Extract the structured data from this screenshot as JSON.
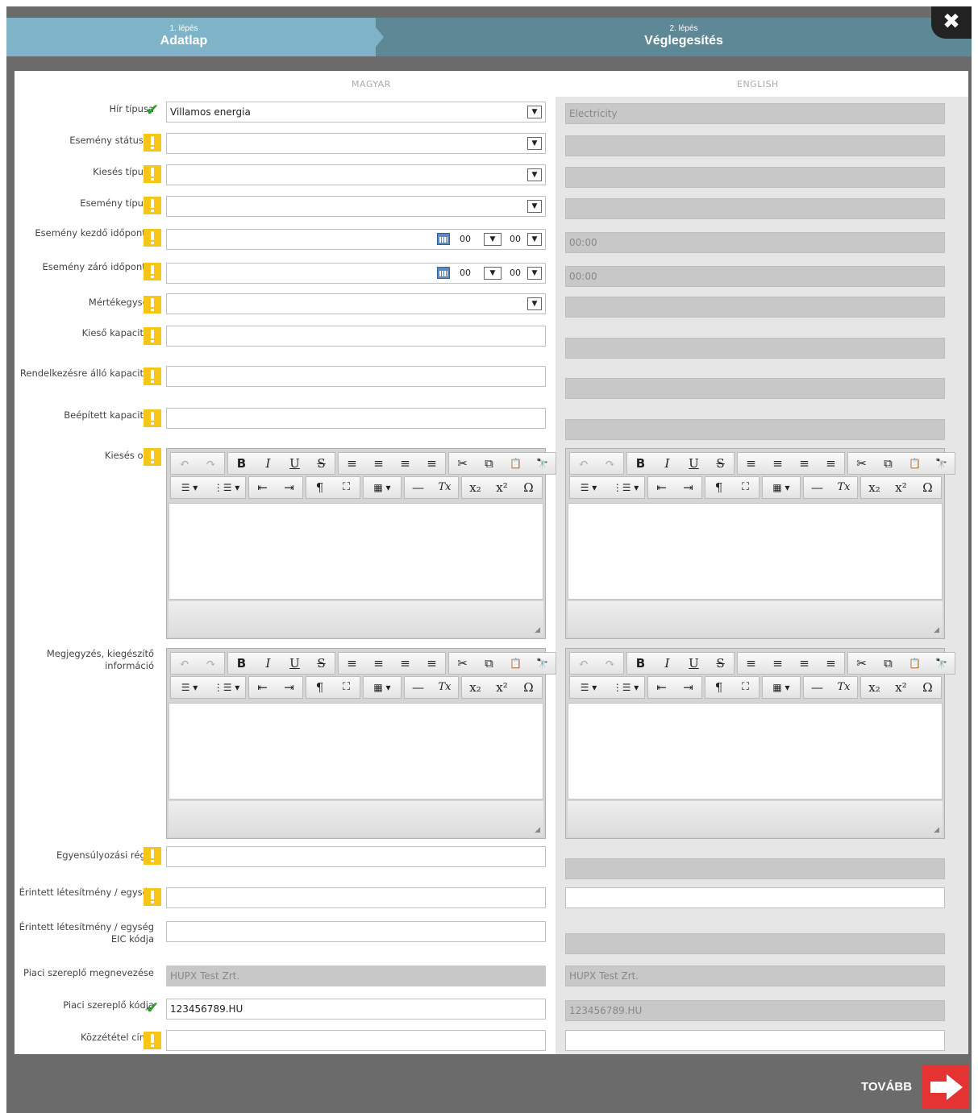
{
  "steps": [
    {
      "num": "1. lépés",
      "name": "Adatlap"
    },
    {
      "num": "2. lépés",
      "name": "Véglegesítés"
    }
  ],
  "close_icon": "✖",
  "columns": {
    "magyar": "MAGYAR",
    "english": "ENGLISH"
  },
  "toolbar": {
    "row1": [
      "↶",
      "↷",
      "B",
      "I",
      "U",
      "S",
      "≡",
      "≡",
      "≡",
      "≡",
      "✂",
      "⧉",
      "📋",
      "🔭"
    ],
    "row2": [
      "☰ ▾",
      "⋮☰ ▾",
      "⇤",
      "⇥",
      "¶",
      "⛶",
      "▦ ▾",
      "—",
      "Tx",
      "x₂",
      "x²",
      "Ω"
    ]
  },
  "form": {
    "hir_tipusa": {
      "label": "Hír típusa",
      "value": "Villamos energia",
      "en_value": "Electricity",
      "status": "ok"
    },
    "esemeny_statusza": {
      "label": "Esemény státusza",
      "value": "",
      "en_value": ""
    },
    "kieses_tipusa": {
      "label": "Kiesés típusa",
      "value": "",
      "en_value": ""
    },
    "esemeny_tipusa": {
      "label": "Esemény típusa",
      "value": "",
      "en_value": ""
    },
    "esemeny_kezdo": {
      "label": "Esemény kezdő időpontja",
      "hour": "00",
      "min": "00",
      "en_value": "00:00"
    },
    "esemeny_zaro": {
      "label": "Esemény záró időpontja",
      "hour": "00",
      "min": "00",
      "en_value": "00:00"
    },
    "mertekegyseg": {
      "label": "Mértékegység",
      "value": "",
      "en_value": ""
    },
    "kieso_kapacitas": {
      "label": "Kieső kapacitás",
      "value": ""
    },
    "rendelkezesre": {
      "label": "Rendelkezésre álló kapacitás",
      "value": ""
    },
    "beepitett": {
      "label": "Beépített kapacitás",
      "value": ""
    },
    "kieses_oka": {
      "label": "Kiesés oka"
    },
    "megjegyzes": {
      "label": "Megjegyzés, kiegészítő információ"
    },
    "egyensulyozasi": {
      "label": "Egyensúlyozási régió",
      "value": ""
    },
    "erintett": {
      "label": "Érintett létesítmény / egység",
      "value": ""
    },
    "erintett_eic": {
      "label": "Érintett létesítmény / egység EIC kódja",
      "value": ""
    },
    "piaci_nev": {
      "label": "Piaci szereplő megnevezése",
      "value": "HUPX Test Zrt.",
      "en_value": "HUPX Test Zrt."
    },
    "piaci_kod": {
      "label": "Piaci szereplő kódja",
      "value": "123456789.HU",
      "en_value": "123456789.HU",
      "status": "ok"
    },
    "kozzetetel": {
      "label": "Közzététel címe",
      "value": ""
    }
  },
  "next": {
    "label": "TOVÁBB"
  }
}
